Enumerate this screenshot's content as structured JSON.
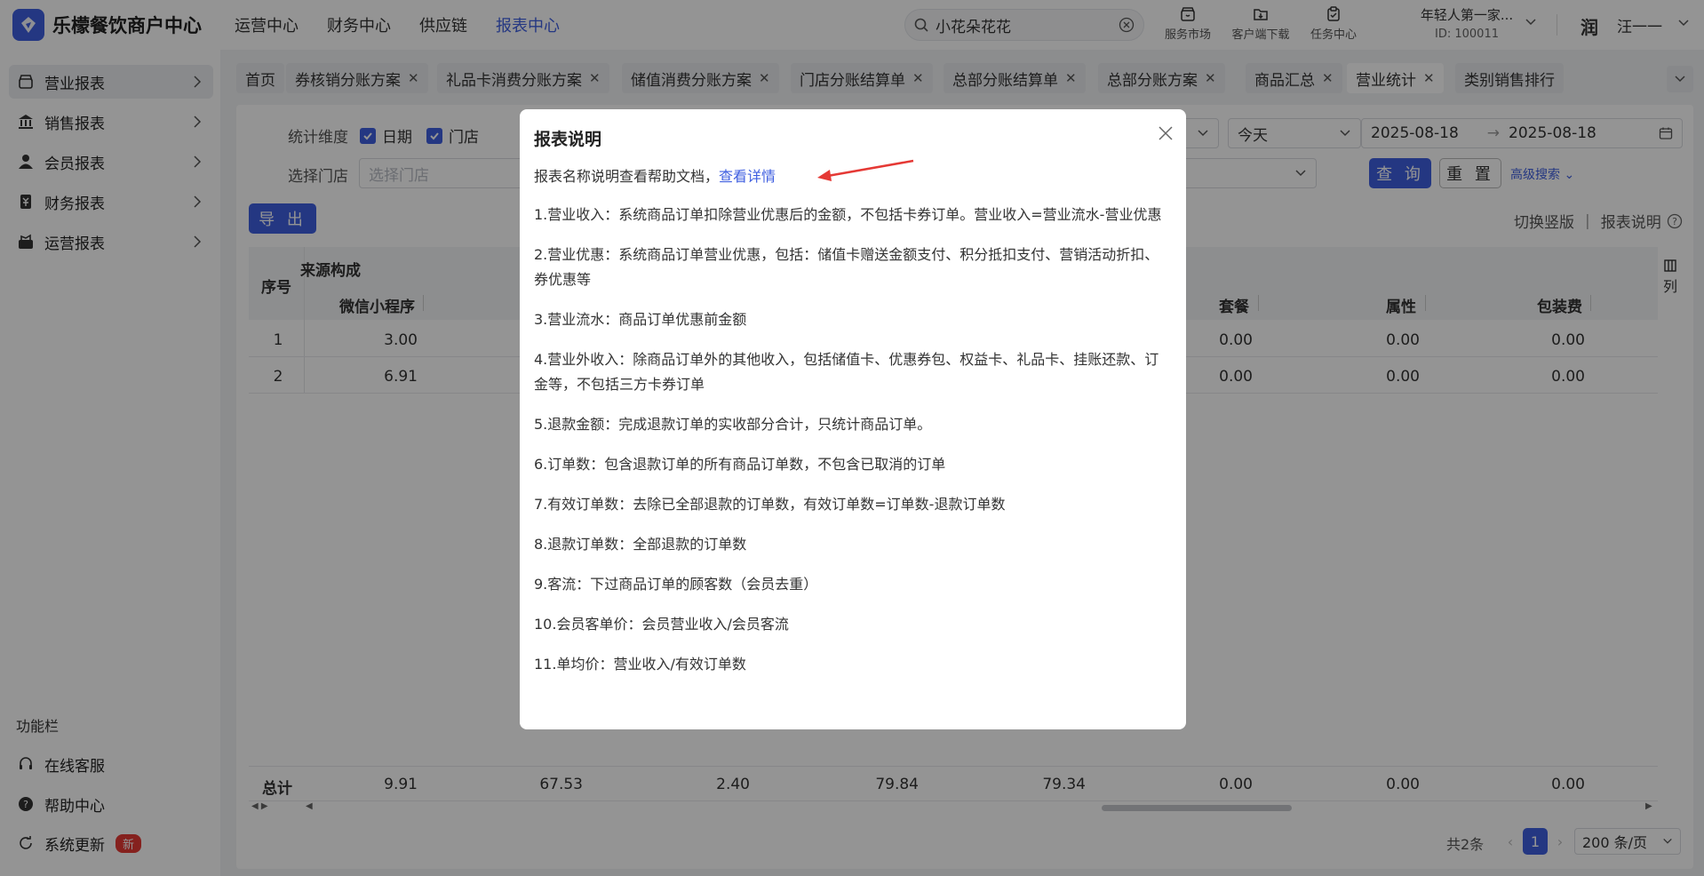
{
  "app": {
    "title": "乐檬餐饮商户中心"
  },
  "topnav": [
    "运营中心",
    "财务中心",
    "供应链",
    "报表中心"
  ],
  "search": {
    "value": "小花朵花花"
  },
  "tools": [
    {
      "icon": "store-icon",
      "label": "服务市场"
    },
    {
      "icon": "download-icon",
      "label": "客户端下载"
    },
    {
      "icon": "task-icon",
      "label": "任务中心"
    }
  ],
  "account": {
    "name": "年轻人第一家...",
    "id": "ID: 100011",
    "avatar_text": "润",
    "user": "汪一一"
  },
  "sidebar": {
    "items": [
      {
        "icon": "store-icon",
        "label": "营业报表"
      },
      {
        "icon": "bank-icon",
        "label": "销售报表"
      },
      {
        "icon": "user-icon",
        "label": "会员报表"
      },
      {
        "icon": "finance-icon",
        "label": "财务报表"
      },
      {
        "icon": "operation-icon",
        "label": "运营报表"
      }
    ],
    "section_title": "功能栏",
    "bottom": [
      {
        "icon": "headset-icon",
        "label": "在线客服"
      },
      {
        "icon": "help-icon",
        "label": "帮助中心"
      },
      {
        "icon": "refresh-icon",
        "label": "系统更新",
        "badge": "新"
      }
    ]
  },
  "tabs": [
    "首页",
    "券核销分账方案",
    "礼品卡消费分账方案",
    "储值消费分账方案",
    "门店分账结算单",
    "总部分账结算单",
    "总部分账方案",
    "商品汇总",
    "营业统计",
    "类别销售排行"
  ],
  "filters": {
    "dimension_label": "统计维度",
    "dim_date": "日期",
    "dim_store": "门店",
    "store_label": "选择门店",
    "store_placeholder": "选择门店",
    "period": "今天",
    "date_start": "2025-08-18",
    "date_end": "2025-08-18",
    "query": "查 询",
    "reset": "重 置",
    "advanced": "高级搜索"
  },
  "actions": {
    "export": "导 出",
    "switch_layout": "切换竖版",
    "report_help": "报表说明"
  },
  "table": {
    "group_header": "来源构成",
    "col_index": "序号",
    "col_wechat": "微信小程序",
    "col_combo": "套餐",
    "col_attr": "属性",
    "col_pack": "包装费",
    "col_toggle": "列",
    "rows": [
      {
        "idx": "1",
        "wechat": "3.00",
        "combo": "0.00",
        "attr": "0.00",
        "pack": "0.00"
      },
      {
        "idx": "2",
        "wechat": "6.91",
        "combo": "0.00",
        "attr": "0.00",
        "pack": "0.00"
      }
    ],
    "total": {
      "label": "总计",
      "v1": "9.91",
      "v2": "67.53",
      "v3": "2.40",
      "v4": "79.84",
      "v5": "79.34",
      "v6": "0.00",
      "v7": "0.00",
      "v8": "0.00"
    }
  },
  "pagination": {
    "total": "共2条",
    "page": "1",
    "size": "200 条/页"
  },
  "modal": {
    "title": "报表说明",
    "intro": "报表名称说明查看帮助文档，",
    "link": "查看详情",
    "items": [
      "1.营业收入：系统商品订单扣除营业优惠后的金额，不包括卡券订单。营业收入=营业流水-营业优惠",
      "2.营业优惠：系统商品订单营业优惠，包括：储值卡赠送金额支付、积分抵扣支付、营销活动折扣、券优惠等",
      "3.营业流水：商品订单优惠前金额",
      "4.营业外收入：除商品订单外的其他收入，包括储值卡、优惠券包、权益卡、礼品卡、挂账还款、订金等，不包括三方卡券订单",
      "5.退款金额：完成退款订单的实收部分合计，只统计商品订单。",
      "6.订单数：包含退款订单的所有商品订单数，不包含已取消的订单",
      "7.有效订单数：去除已全部退款的订单数，有效订单数=订单数-退款订单数",
      "8.退款订单数：全部退款的订单数",
      "9.客流：下过商品订单的顾客数（会员去重）",
      "10.会员客单价：会员营业收入/会员客流",
      "11.单均价：营业收入/有效订单数"
    ]
  },
  "colors": {
    "primary": "#3f5fe0",
    "arrow": "#e53935",
    "badge": "#e53935"
  }
}
